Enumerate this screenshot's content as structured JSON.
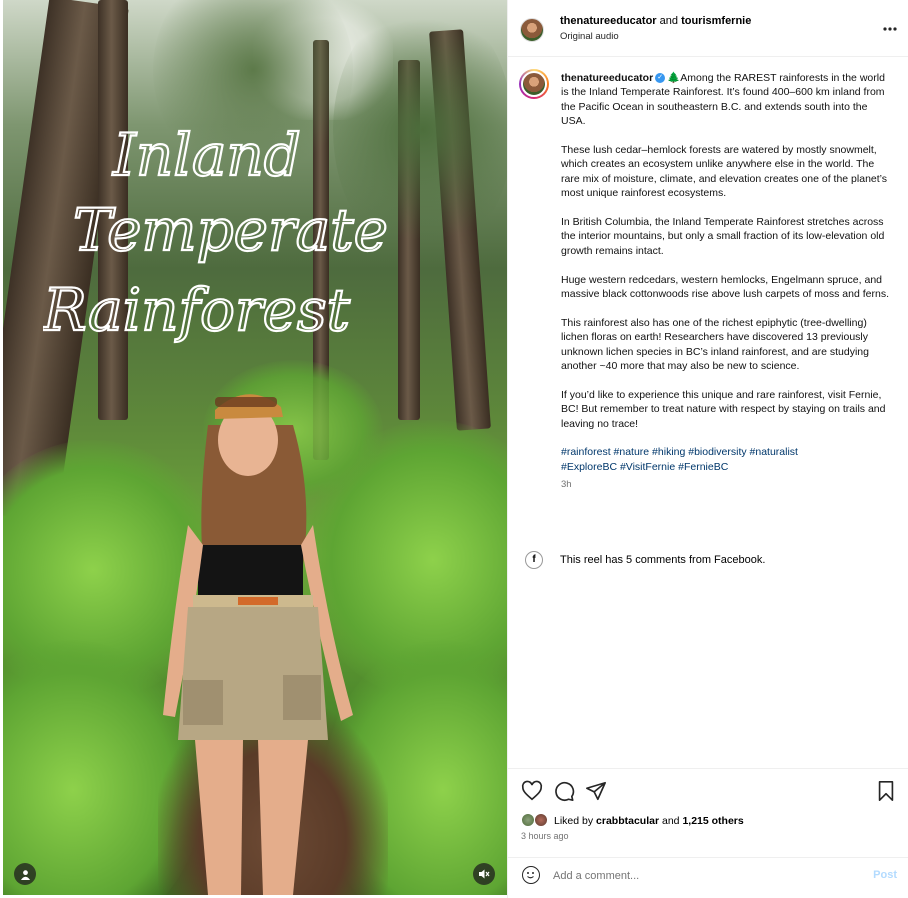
{
  "media": {
    "overlay_text": [
      "Inland",
      "Temperate",
      "Rainforest"
    ]
  },
  "header": {
    "account": "thenatureeducator",
    "joiner": "and",
    "collaborator": "tourismfernie",
    "audio": "Original audio",
    "more_icon": "more-horizontal-icon"
  },
  "caption": {
    "username": "thenatureeducator",
    "paragraphs": [
      "🌲Among the RAREST rainforests in the world is the Inland Temperate Rainforest. It’s found 400–600 km inland from the Pacific Ocean in southeastern B.C. and extends south into the USA.",
      "These lush cedar–hemlock forests are watered by mostly snowmelt, which creates an ecosystem unlike anywhere else in the world. The rare mix of moisture, climate, and elevation creates one of the planet’s most unique rainforest ecosystems.",
      "In British Columbia, the Inland Temperate Rainforest stretches across the interior mountains, but only a small fraction of its low-elevation old growth remains intact.",
      "Huge western redcedars, western hemlocks, Engelmann spruce, and massive black cottonwoods rise above lush carpets of moss and ferns.",
      "This rainforest also has one of the richest epiphytic (tree-dwelling) lichen floras on earth! Researchers have discovered 13 previously unknown lichen species in BC’s inland rainforest, and are studying another ~40 more that may also be new to science.",
      "If you’d like to experience this unique and rare rainforest, visit Fernie, BC! But remember to treat nature with respect by staying on trails and leaving no trace!"
    ],
    "hashtags_line1": "#rainforest #nature #hiking #biodiversity #naturalist",
    "hashtags_line2": "#ExploreBC #VisitFernie #FernieBC",
    "age": "3h"
  },
  "facebook": {
    "text": "This reel has 5 comments from Facebook."
  },
  "likes": {
    "prefix": "Liked by",
    "user": "crabbtacular",
    "joiner": "and",
    "others": "1,215 others",
    "time": "3 hours ago"
  },
  "comment": {
    "placeholder": "Add a comment...",
    "post_label": "Post"
  },
  "colors": {
    "link": "#00376b",
    "verified": "#3797f0",
    "post_disabled": "#b3dbff"
  }
}
